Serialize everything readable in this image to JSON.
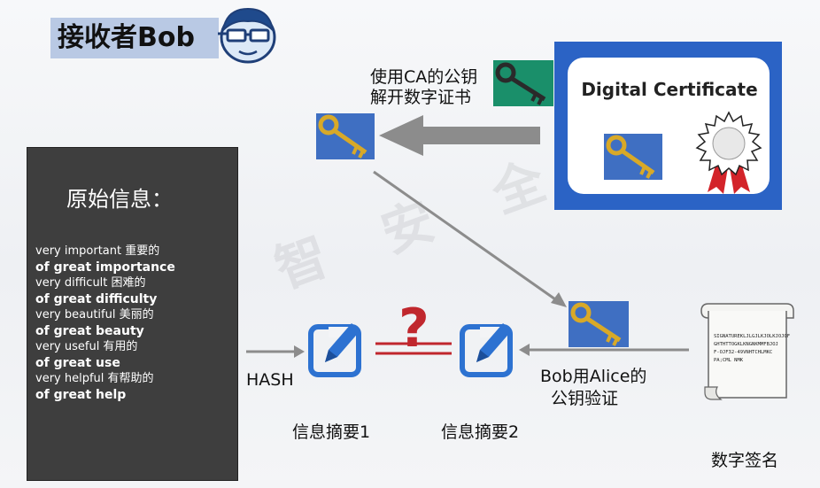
{
  "title": "接收者Bob",
  "panel": {
    "title": "原始信息：",
    "phrases": [
      {
        "text": "very important 重要的",
        "bold": false
      },
      {
        "text": "of great importance",
        "bold": true
      },
      {
        "text": "very difficult 困难的",
        "bold": false
      },
      {
        "text": "of great difficulty",
        "bold": true
      },
      {
        "text": "very beautiful 美丽的",
        "bold": false
      },
      {
        "text": "of great beauty",
        "bold": true
      },
      {
        "text": "very useful 有用的",
        "bold": false
      },
      {
        "text": "of great use",
        "bold": true
      },
      {
        "text": "very helpful 有帮助的",
        "bold": false
      },
      {
        "text": "of great help",
        "bold": true
      }
    ]
  },
  "ca_text": {
    "line1": "使用CA的公钥",
    "line2": "解开数字证书"
  },
  "certificate": {
    "title": "Digital Certificate"
  },
  "labels": {
    "hash": "HASH",
    "digest1": "信息摘要1",
    "digest2": "信息摘要2",
    "verify_line1": "Bob用Alice的",
    "verify_line2": "公钥验证",
    "signature": "数字签名",
    "question": "?"
  },
  "signature_text": [
    "SIGNATUREKLJLGJLKJOLKJOJOF",
    "GHTHTTOGKLKNGNKMMFBJOJ",
    "F-OJF32-49VNHTCHLMKC",
    "PA;CML NMK"
  ],
  "colors": {
    "accent_blue": "#2b63c5",
    "question_red": "#c0272d",
    "panel_bg": "#3e3e3e"
  }
}
